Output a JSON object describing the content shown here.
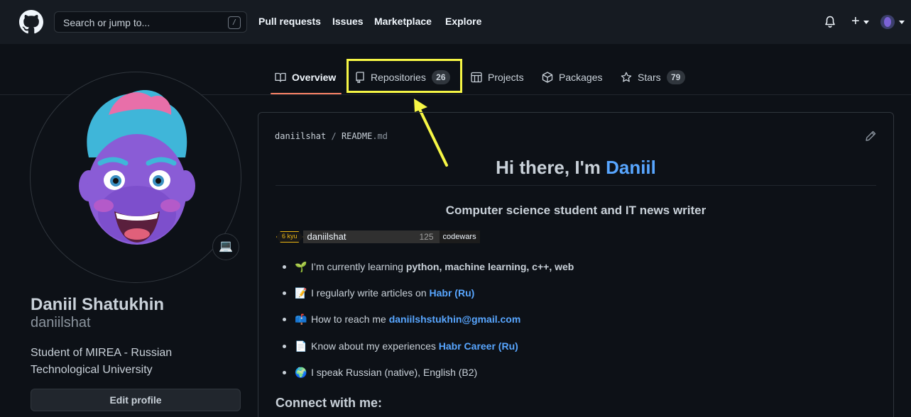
{
  "header": {
    "search_placeholder": "Search or jump to...",
    "slash_hint": "/",
    "nav": [
      "Pull requests",
      "Issues",
      "Marketplace",
      "Explore"
    ],
    "plus": "+"
  },
  "tabs": [
    {
      "label": "Overview",
      "icon": "book-icon",
      "active": true
    },
    {
      "label": "Repositories",
      "icon": "repo-icon",
      "count": "26"
    },
    {
      "label": "Projects",
      "icon": "project-icon"
    },
    {
      "label": "Packages",
      "icon": "package-icon"
    },
    {
      "label": "Stars",
      "icon": "star-icon",
      "count": "79"
    }
  ],
  "profile": {
    "full_name": "Daniil Shatukhin",
    "username": "daniilshat",
    "bio": "Student of MIREA - Russian Technological University",
    "edit_button": "Edit profile",
    "status_emoji": "💻"
  },
  "readme": {
    "crumb_user": "daniilshat",
    "crumb_sep": "/",
    "crumb_file": "README",
    "crumb_ext": ".md",
    "greeting": "Hi there, I'm ",
    "greeting_link": "Daniil",
    "subtitle": "Computer science student and IT news writer",
    "codewars": {
      "rank": "6 kyu",
      "name": "daniilshat",
      "honor": "125",
      "site": "codewars"
    },
    "items": [
      {
        "emoji": "🌱",
        "text": "I’m currently learning ",
        "bold": "python, machine learning, c++, web"
      },
      {
        "emoji": "📝",
        "text": "I regularly write articles on ",
        "link": "Habr (Ru)"
      },
      {
        "emoji": "📫",
        "text": "How to reach me ",
        "link": "daniilshstukhin@gmail.com"
      },
      {
        "emoji": "📄",
        "text": "Know about my experiences ",
        "link": "Habr Career (Ru)"
      },
      {
        "emoji": "🌍",
        "text": "I speak Russian (native), English (B2)"
      }
    ],
    "connect_heading": "Connect with me:"
  },
  "colors": {
    "accent": "#f78166",
    "link": "#58a6ff",
    "highlight": "#f6f645",
    "background": "#0d1117"
  }
}
